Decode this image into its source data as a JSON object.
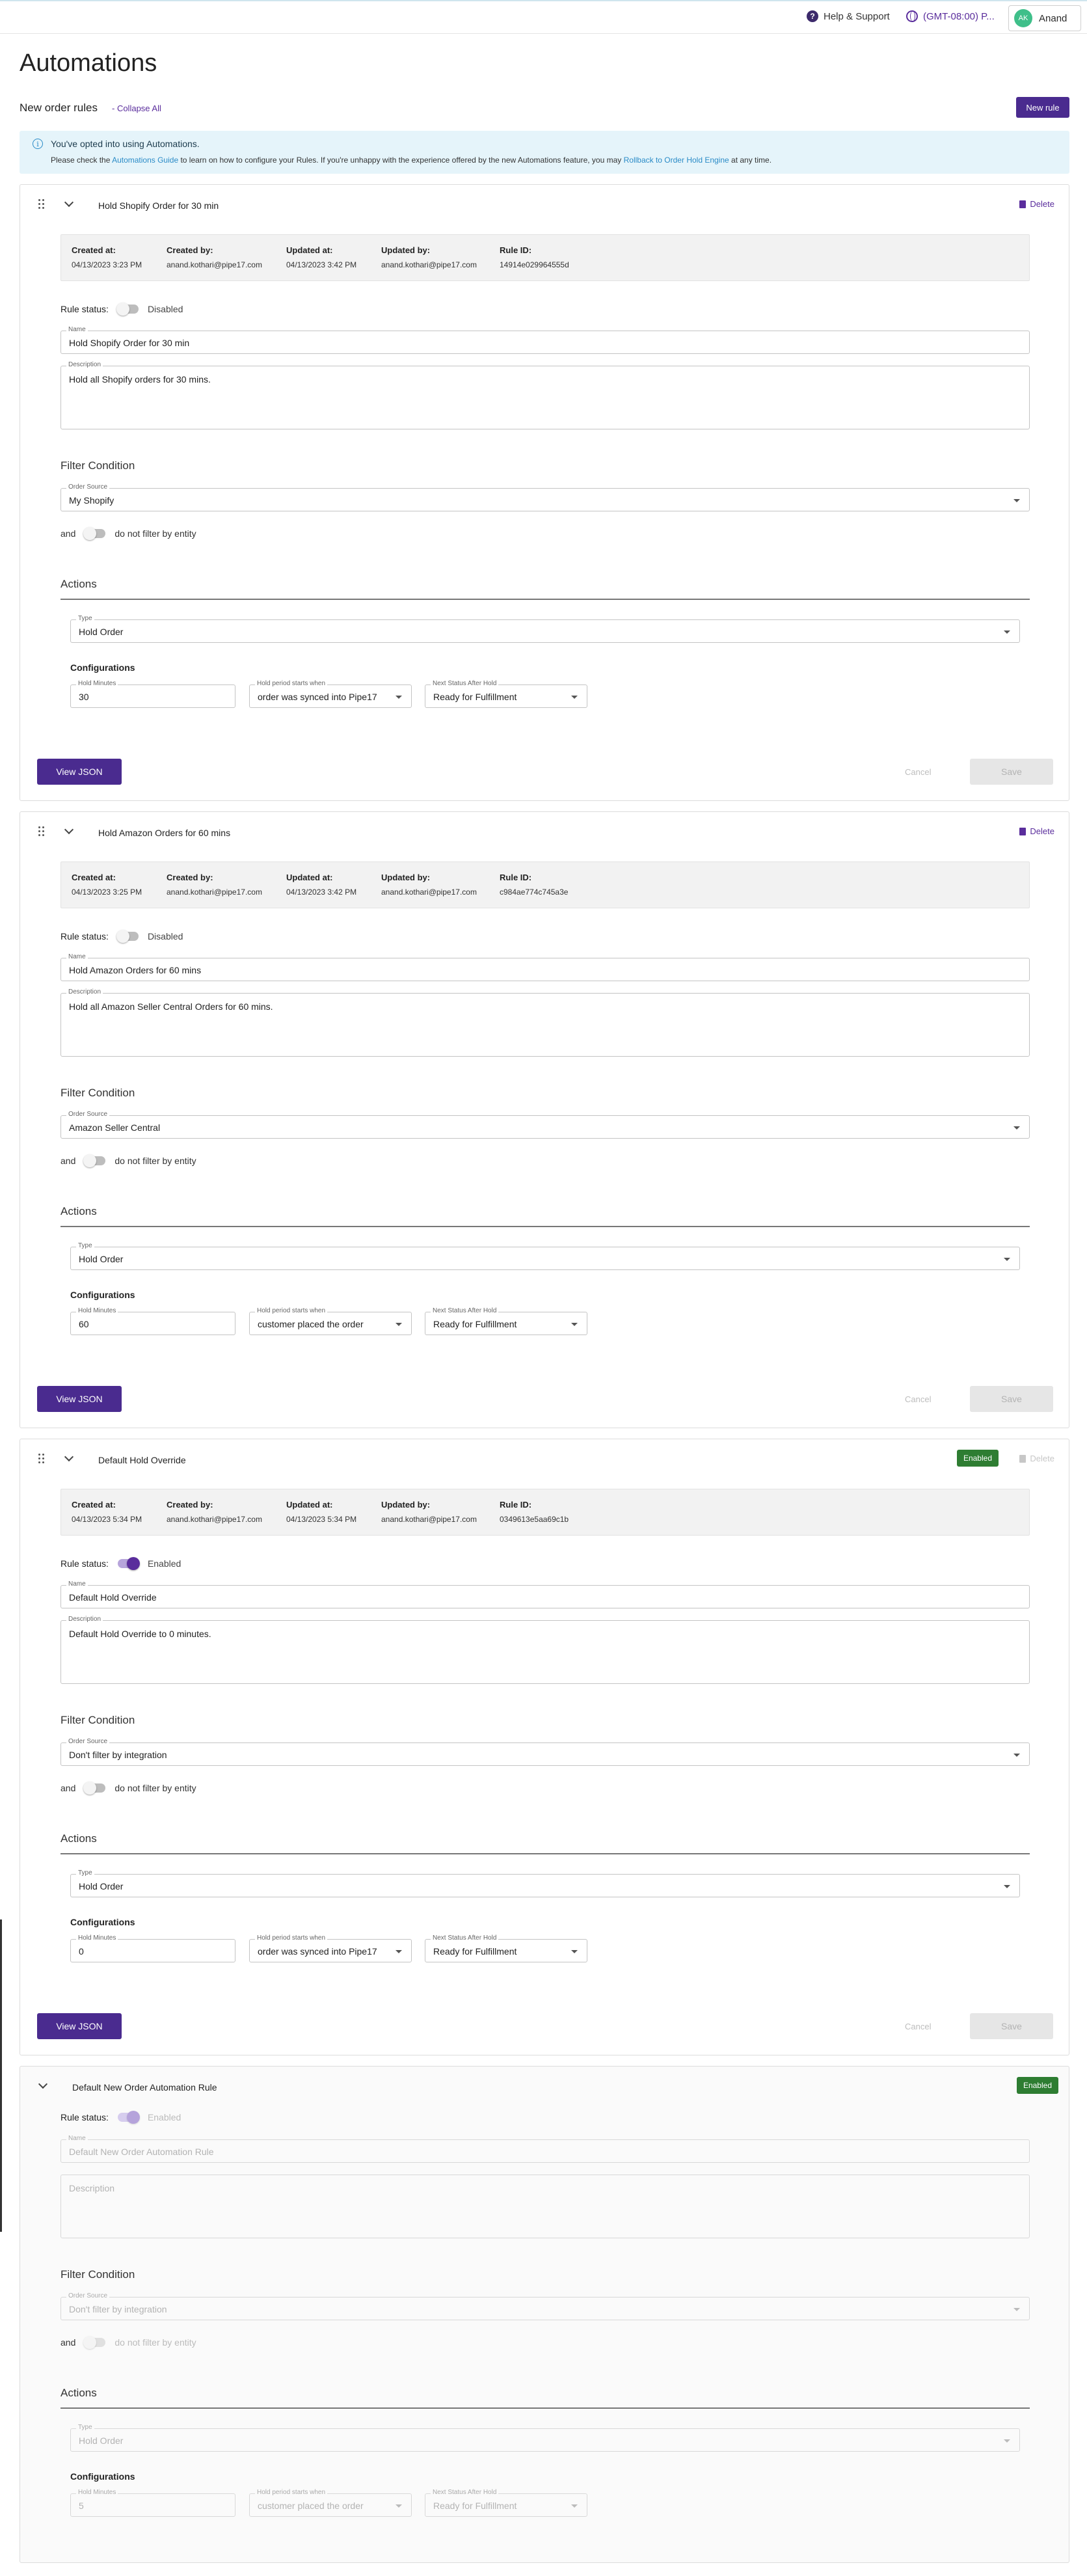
{
  "topbar": {
    "help_label": "Help & Support",
    "help_icon": "?",
    "timezone_label": "(GMT-08:00) P...",
    "user_initials": "AK",
    "user_name": "Anand"
  },
  "page": {
    "title": "Automations",
    "subhead": "New order rules",
    "collapse_all": "- Collapse All",
    "new_rule": "New rule"
  },
  "banner": {
    "title": "You've opted into using Automations.",
    "msg_before": "Please check the ",
    "guide_link": "Automations Guide",
    "msg_middle": " to learn on how to configure your Rules. If you're unhappy with the experience offered by the new Automations feature, you may ",
    "rollback_link": "Rollback to Order Hold Engine",
    "msg_after": " at any time."
  },
  "labels": {
    "created_at": "Created at:",
    "created_by": "Created by:",
    "updated_at": "Updated at:",
    "updated_by": "Updated by:",
    "rule_id": "Rule ID:",
    "rule_status": "Rule status:",
    "name": "Name",
    "description": "Description",
    "filter_condition": "Filter Condition",
    "order_source": "Order Source",
    "and": "and",
    "actions": "Actions",
    "type": "Type",
    "configurations": "Configurations",
    "hold_minutes": "Hold Minutes",
    "hold_period": "Hold period starts when",
    "next_status": "Next Status After Hold",
    "view_json": "View JSON",
    "cancel": "Cancel",
    "save": "Save",
    "delete": "Delete"
  },
  "rules": [
    {
      "title": "Hold Shopify Order for 30 min",
      "badge": "",
      "created_at": "04/13/2023 3:23 PM",
      "created_by": "anand.kothari@pipe17.com",
      "updated_at": "04/13/2023 3:42 PM",
      "updated_by": "anand.kothari@pipe17.com",
      "rule_id": "14914e029964555d",
      "status": "Disabled",
      "name": "Hold Shopify Order for 30 min",
      "description": "Hold all Shopify orders for 30 mins.",
      "order_source": "My Shopify",
      "entity_filter": "do not filter by entity",
      "type": "Hold Order",
      "hold_minutes": "30",
      "hold_period": "order was synced into Pipe17",
      "next_status": "Ready for Fulfillment"
    },
    {
      "title": "Hold Amazon Orders for 60 mins",
      "badge": "",
      "created_at": "04/13/2023 3:25 PM",
      "created_by": "anand.kothari@pipe17.com",
      "updated_at": "04/13/2023 3:42 PM",
      "updated_by": "anand.kothari@pipe17.com",
      "rule_id": "c984ae774c745a3e",
      "status": "Disabled",
      "name": "Hold Amazon Orders for 60 mins",
      "description": "Hold all Amazon Seller Central Orders for 60 mins.",
      "order_source": "Amazon Seller Central",
      "entity_filter": "do not filter by entity",
      "type": "Hold Order",
      "hold_minutes": "60",
      "hold_period": "customer placed the order",
      "next_status": "Ready for Fulfillment"
    },
    {
      "title": "Default Hold Override",
      "badge": "Enabled",
      "created_at": "04/13/2023 5:34 PM",
      "created_by": "anand.kothari@pipe17.com",
      "updated_at": "04/13/2023 5:34 PM",
      "updated_by": "anand.kothari@pipe17.com",
      "rule_id": "0349613e5aa69c1b",
      "status": "Enabled",
      "name": "Default Hold Override",
      "description": "Default Hold Override to 0 minutes.",
      "order_source": "Don't filter by integration",
      "entity_filter": "do not filter by entity",
      "type": "Hold Order",
      "hold_minutes": "0",
      "hold_period": "order was synced into Pipe17",
      "next_status": "Ready for Fulfillment"
    },
    {
      "title": "Default New Order Automation Rule",
      "badge": "Enabled",
      "status": "Enabled",
      "name": "Default New Order Automation Rule",
      "description": "",
      "order_source": "Don't filter by integration",
      "entity_filter": "do not filter by entity",
      "type": "Hold Order",
      "hold_minutes": "5",
      "hold_period": "customer placed the order",
      "next_status": "Ready for Fulfillment"
    }
  ]
}
